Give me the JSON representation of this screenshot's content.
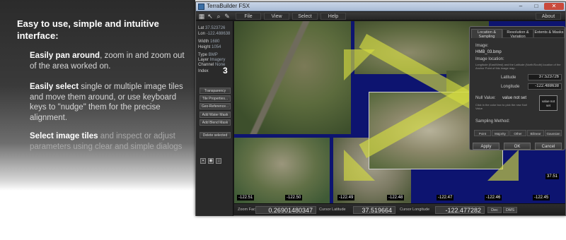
{
  "promo": {
    "title": "Easy to use, simple and intuitive interface:",
    "features": [
      {
        "lead": "Easily pan around",
        "rest": ", zoom in and zoom out of the area worked on."
      },
      {
        "lead": "Easily select",
        "rest": " single or multiple image tiles and move them around, or use keyboard keys to \"nudge\" them for the precise alignment."
      },
      {
        "lead": "Select image tiles",
        "rest": " and inspect or adjust parameters using clear and simple dialogs"
      }
    ]
  },
  "window": {
    "title": "TerraBuilder FSX",
    "controls": {
      "minimize": "–",
      "maximize": "□",
      "close": "✕"
    }
  },
  "menu": {
    "file": "File",
    "view": "View",
    "select": "Select",
    "help": "Help",
    "about": "About"
  },
  "sidebar": {
    "lat_label": "Lat",
    "lat_value": "37.523726",
    "lon_label": "Lon",
    "lon_value": "-122.488638",
    "width_label": "Width",
    "width_value": "1680",
    "height_label": "Height",
    "height_value": "1054",
    "type_label": "Type",
    "type_value": "BMP",
    "layer_label": "Layer",
    "layer_value": "Imagery",
    "channel_label": "Channel",
    "channel_value": "None",
    "index_label": "Index",
    "index_value": "3",
    "buttons": [
      "Transparency",
      "Tile Properties...",
      "Geo-Reference...",
      "Add Water Mask",
      "Add Blend Mask",
      "Delete selected"
    ]
  },
  "map": {
    "bottom_coords": [
      "-122.51",
      "-122.50",
      "-122.49",
      "-122.48",
      "-122.47",
      "-122.46",
      "-122.45"
    ],
    "side_coord": "37.51"
  },
  "dialog": {
    "tabs": [
      "Location & Sampling",
      "Resolution & Variation",
      "Extents & Masks"
    ],
    "image_label": "Image:",
    "image_name": "HMB_03.bmp",
    "location_label": "Image location:",
    "location_hint": "Longitude (East/West) and the Latitude (North/South) location of the Anchor Point of this image map.",
    "latitude_label": "Latitude",
    "latitude_value": "37.523726",
    "longitude_label": "Longitude",
    "longitude_value": "-122.488638",
    "null_label": "Null Value:",
    "null_value": "value not set",
    "null_hint": "Click in the color box to pick the new Null Value.",
    "color_box_text": "value not set",
    "sampling_label": "Sampling Method:",
    "sampling_options": [
      "Point",
      "Majority",
      "Other",
      "Bilinear",
      "Gaussian"
    ],
    "apply": "Apply",
    "ok": "OK",
    "cancel": "Cancel"
  },
  "status": {
    "zoom_label": "Zoom Factor",
    "zoom_value": "0.26901480347",
    "lat_label": "Cursor Latitude",
    "lat_value": "37.519664",
    "lon_label": "Cursor Longitude",
    "lon_value": "-122.477282",
    "dec": "Dec",
    "dms": "DMS"
  },
  "colors": {
    "map_water": "#0d1470",
    "arrow": "#d6dd40",
    "promo_bg": "#2b2b2b"
  }
}
